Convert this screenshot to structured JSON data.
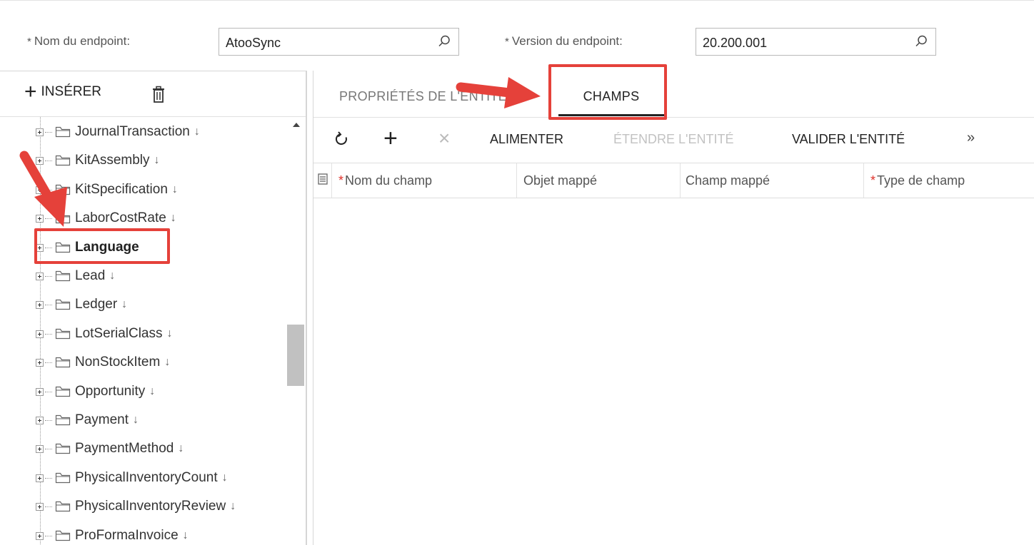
{
  "header": {
    "endpoint_name": {
      "label": "Nom du endpoint:",
      "value": "AtooSync"
    },
    "endpoint_version": {
      "label": "Version du endpoint:",
      "value": "20.200.001"
    }
  },
  "left_panel": {
    "insert_label": "INSÉRER",
    "tree": [
      {
        "label": "JournalTransaction",
        "selected": false
      },
      {
        "label": "KitAssembly",
        "selected": false
      },
      {
        "label": "KitSpecification",
        "selected": false
      },
      {
        "label": "LaborCostRate",
        "selected": false
      },
      {
        "label": "Language",
        "selected": true
      },
      {
        "label": "Lead",
        "selected": false
      },
      {
        "label": "Ledger",
        "selected": false
      },
      {
        "label": "LotSerialClass",
        "selected": false
      },
      {
        "label": "NonStockItem",
        "selected": false
      },
      {
        "label": "Opportunity",
        "selected": false
      },
      {
        "label": "Payment",
        "selected": false
      },
      {
        "label": "PaymentMethod",
        "selected": false
      },
      {
        "label": "PhysicalInventoryCount",
        "selected": false
      },
      {
        "label": "PhysicalInventoryReview",
        "selected": false
      },
      {
        "label": "ProFormaInvoice",
        "selected": false
      }
    ]
  },
  "right_panel": {
    "tabs": [
      {
        "label": "PROPRIÉTÉS DE L'ENTITÉ",
        "active": false
      },
      {
        "label": "CHAMPS",
        "active": true
      }
    ],
    "toolbar": {
      "alimenter": "ALIMENTER",
      "etendre": "ÉTENDRE L'ENTITÉ",
      "valider": "VALIDER L'ENTITÉ",
      "more": "»"
    },
    "columns": [
      {
        "label": "Nom du champ",
        "required": true
      },
      {
        "label": "Objet mappé",
        "required": false
      },
      {
        "label": "Champ mappé",
        "required": false
      },
      {
        "label": "Type de champ",
        "required": true
      }
    ]
  },
  "colors": {
    "annotation": "#e5413a",
    "required_marker": "#e0322b"
  }
}
